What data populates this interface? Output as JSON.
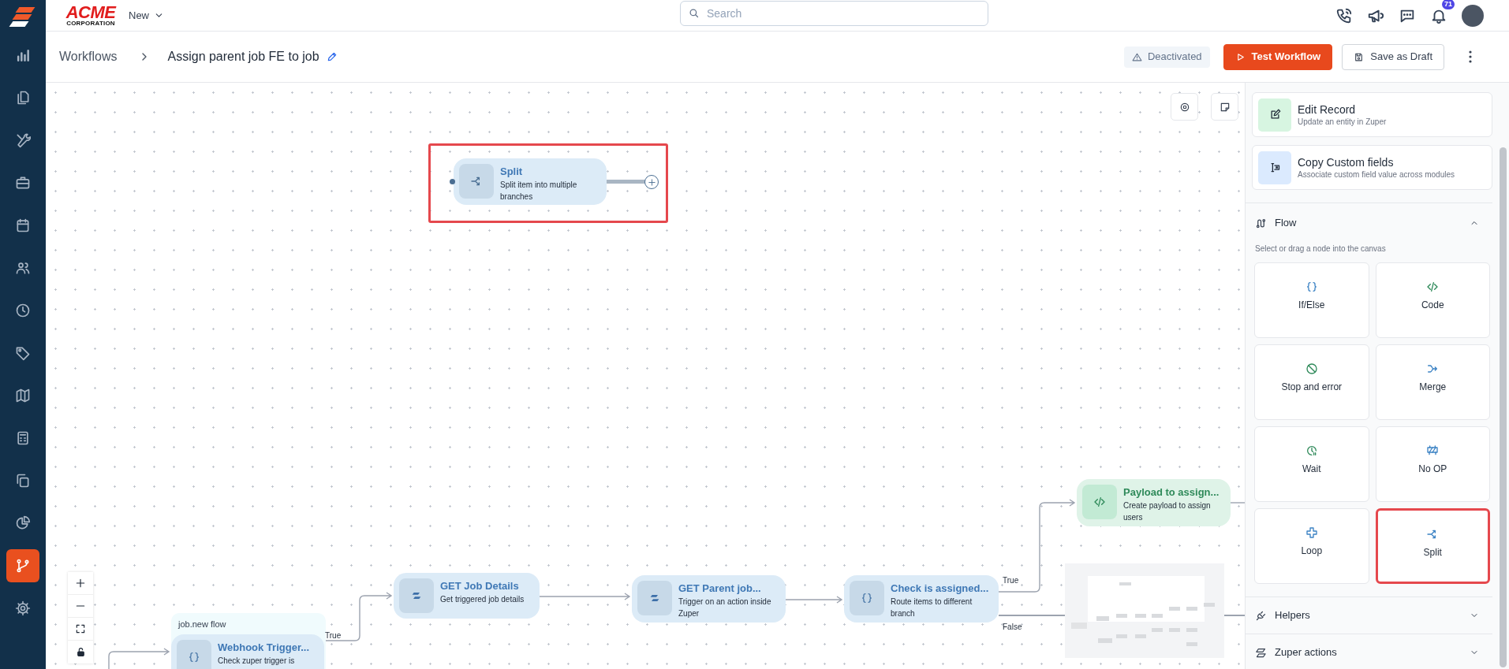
{
  "topbar": {
    "logo": {
      "title": "ACME",
      "subtitle": "CORPORATION"
    },
    "new_menu": "New",
    "search": {
      "placeholder": "Search"
    },
    "notifications": {
      "count": "71"
    }
  },
  "sidebar": {
    "items": [
      {
        "kind": "chart",
        "selected": false
      },
      {
        "kind": "docs",
        "selected": false
      },
      {
        "kind": "tools",
        "selected": false
      },
      {
        "kind": "briefcase",
        "selected": false
      },
      {
        "kind": "calendar",
        "selected": false
      },
      {
        "kind": "users",
        "selected": false
      },
      {
        "kind": "clock",
        "selected": false
      },
      {
        "kind": "tag",
        "selected": false
      },
      {
        "kind": "map",
        "selected": false
      },
      {
        "kind": "calculator",
        "selected": false
      },
      {
        "kind": "copy",
        "selected": false
      },
      {
        "kind": "pie",
        "selected": false
      },
      {
        "kind": "workflow",
        "selected": true
      },
      {
        "kind": "settings",
        "selected": false
      }
    ]
  },
  "header": {
    "breadcrumb": "Workflows",
    "title": "Assign parent job FE to job",
    "status": "Deactivated",
    "buttons": [
      {
        "kind": "primary",
        "label": "Test Workflow"
      },
      {
        "kind": "secondary",
        "label": "Save as Draft"
      }
    ]
  },
  "canvas": {
    "group": {
      "label": "job.new flow"
    },
    "nodes": [
      {
        "kind": "split",
        "title": "Split",
        "description": "Split item into multiple branches",
        "highlighted": true
      },
      {
        "kind": "condition",
        "title": "Webhook Trigger...",
        "description": "Check zuper trigger is",
        "highlighted": false
      },
      {
        "kind": "zuper",
        "title": "GET Job Details",
        "description": "Get triggered job details",
        "highlighted": false
      },
      {
        "kind": "zuper",
        "title": "GET Parent job...",
        "description": "Trigger on an action inside Zuper",
        "highlighted": false
      },
      {
        "kind": "condition",
        "title": "Check is assigned...",
        "description": "Route items to different branch",
        "highlighted": false
      },
      {
        "kind": "code",
        "title": "Payload to assign...",
        "description": "Create payload to assign users",
        "highlighted": false
      }
    ],
    "edge_labels": [
      "True",
      "True",
      "False"
    ]
  },
  "panel": {
    "cards": [
      {
        "kind": "edit",
        "title": "Edit Record",
        "description": "Update an entity in Zuper"
      },
      {
        "kind": "copy",
        "title": "Copy Custom fields",
        "description": "Associate custom field value across modules"
      }
    ],
    "sections": [
      {
        "kind": "flow",
        "title": "Flow",
        "expanded": true,
        "hint": "Select or drag a node into the canvas",
        "tiles": [
          {
            "kind": "ifelse",
            "label": "If/Else",
            "highlighted": false
          },
          {
            "kind": "code",
            "label": "Code",
            "highlighted": false
          },
          {
            "kind": "stop",
            "label": "Stop and error",
            "highlighted": false
          },
          {
            "kind": "merge",
            "label": "Merge",
            "highlighted": false
          },
          {
            "kind": "wait",
            "label": "Wait",
            "highlighted": false
          },
          {
            "kind": "noop",
            "label": "No OP",
            "highlighted": false
          },
          {
            "kind": "loop",
            "label": "Loop",
            "highlighted": false
          },
          {
            "kind": "split",
            "label": "Split",
            "highlighted": true
          }
        ]
      },
      {
        "kind": "helpers",
        "title": "Helpers",
        "expanded": false
      },
      {
        "kind": "zuper",
        "title": "Zuper actions",
        "expanded": false
      }
    ]
  }
}
